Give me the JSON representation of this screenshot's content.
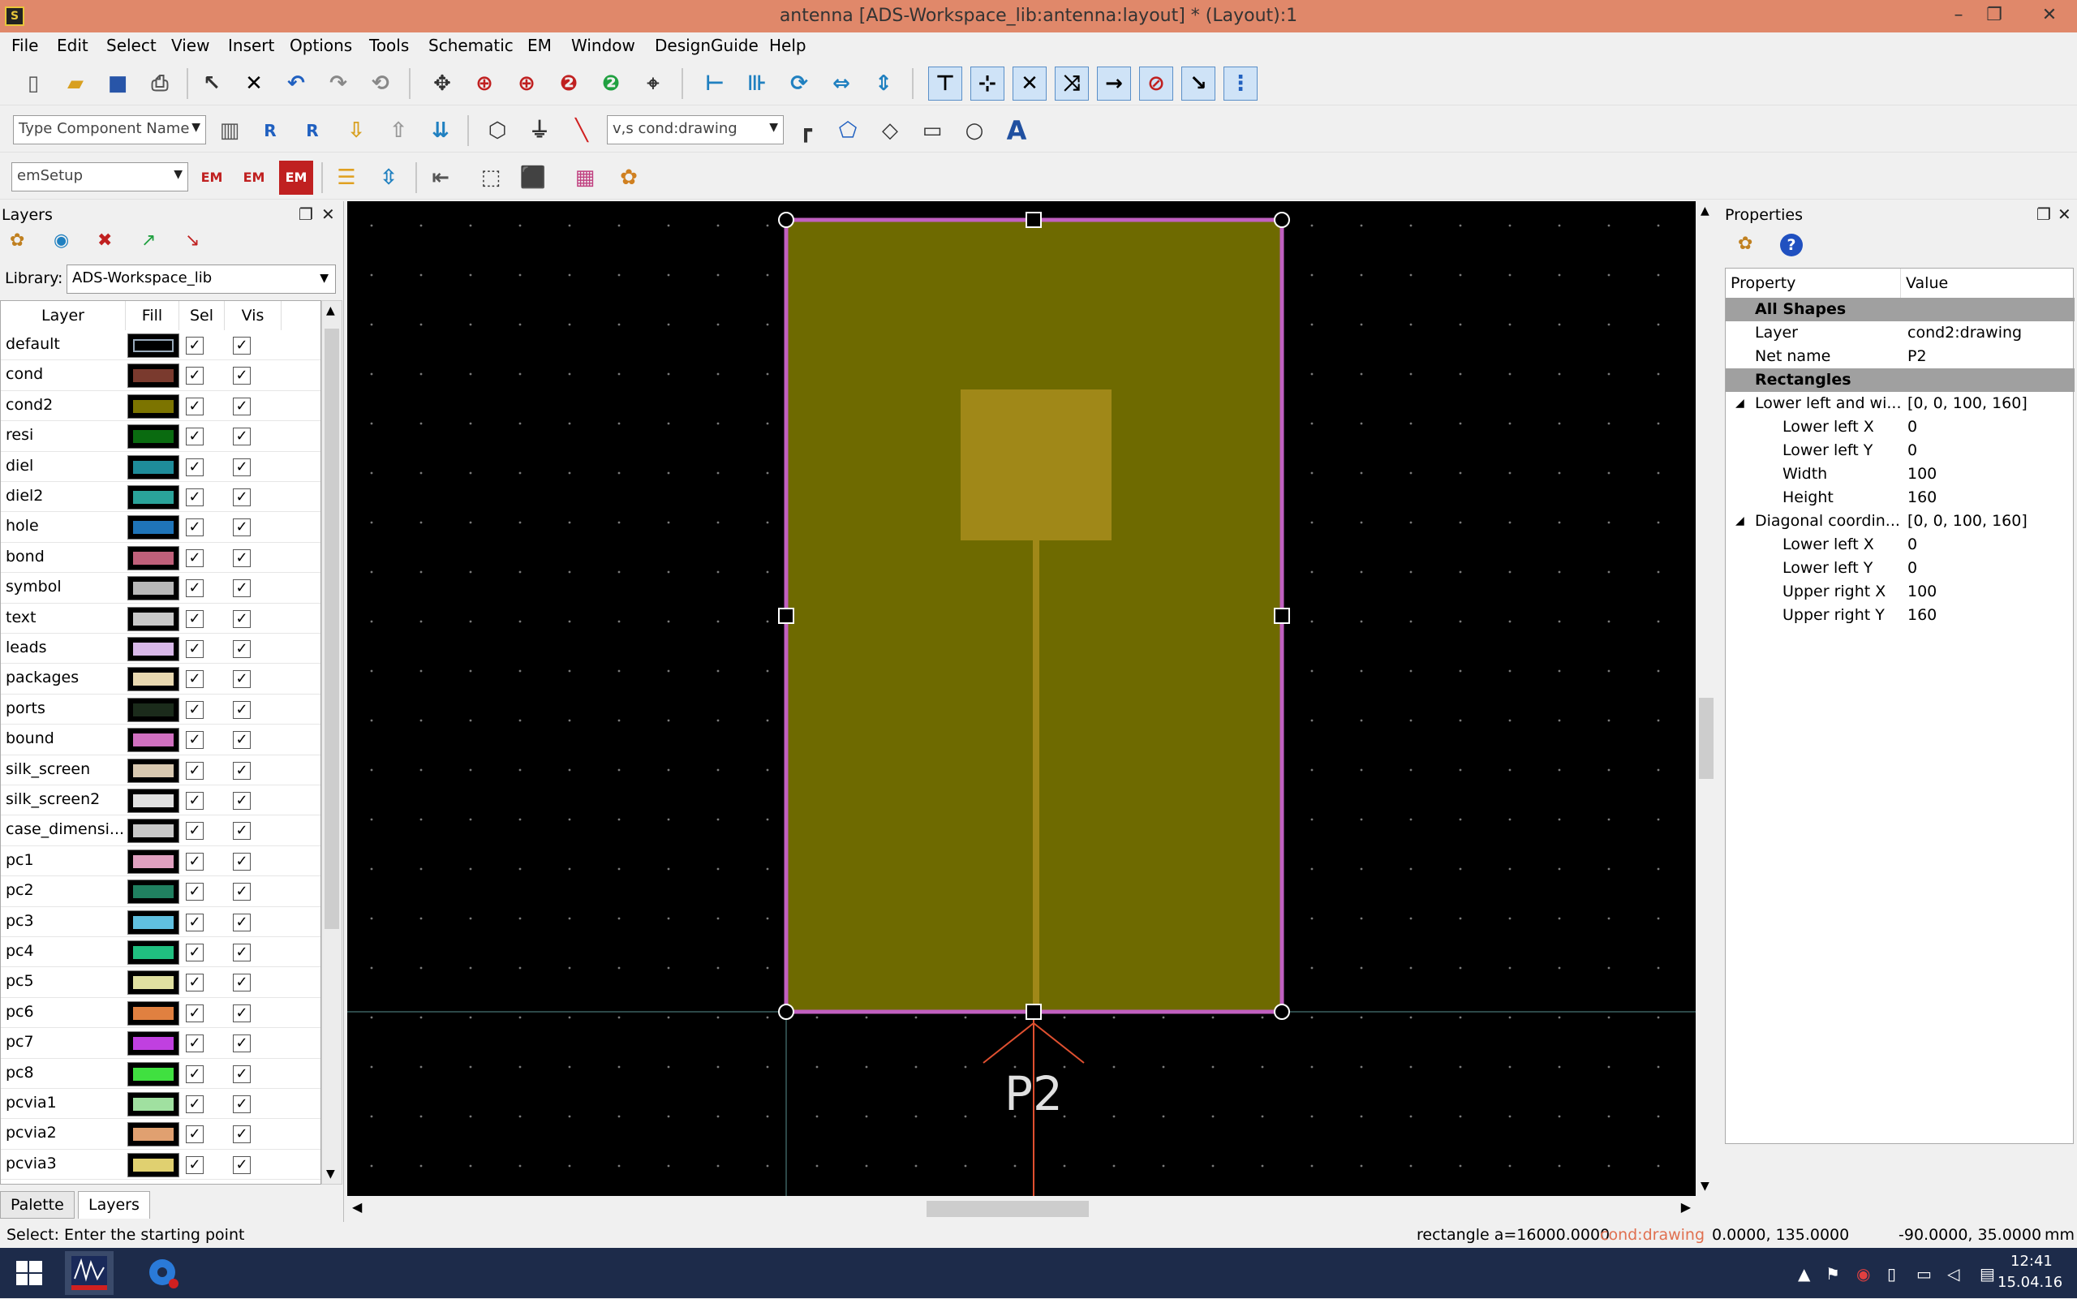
{
  "window": {
    "title": "antenna [ADS-Workspace_lib:antenna:layout] * (Layout):1",
    "minimize": "–",
    "restore": "❐",
    "close": "✕"
  },
  "menu": [
    "File",
    "Edit",
    "Select",
    "View",
    "Insert",
    "Options",
    "Tools",
    "Schematic",
    "EM",
    "Window",
    "DesignGuide",
    "Help"
  ],
  "toolbar": {
    "component_placeholder": "Type Component Name",
    "layer_combo": "v,s cond:drawing",
    "em_combo": "emSetup",
    "em_label": "EM"
  },
  "layers_panel": {
    "title": "Layers",
    "library_label": "Library:",
    "library_value": "ADS-Workspace_lib",
    "columns": [
      "Layer",
      "Fill",
      "Sel",
      "Vis"
    ],
    "layers": [
      {
        "name": "default",
        "color": "#000000"
      },
      {
        "name": "cond",
        "color": "#7a3a2e"
      },
      {
        "name": "cond2",
        "color": "#7c7400"
      },
      {
        "name": "resi",
        "color": "#0a6b10"
      },
      {
        "name": "diel",
        "color": "#1e8c9a"
      },
      {
        "name": "diel2",
        "color": "#2aa39a"
      },
      {
        "name": "hole",
        "color": "#1f74b8"
      },
      {
        "name": "bond",
        "color": "#c0607a"
      },
      {
        "name": "symbol",
        "color": "#b8b8b8"
      },
      {
        "name": "text",
        "color": "#c8c8c8"
      },
      {
        "name": "leads",
        "color": "#d8b8e8"
      },
      {
        "name": "packages",
        "color": "#e8d8b0"
      },
      {
        "name": "ports",
        "color": "#1b2b1b"
      },
      {
        "name": "bound",
        "color": "#d070c0"
      },
      {
        "name": "silk_screen",
        "color": "#d8c8b0"
      },
      {
        "name": "silk_screen2",
        "color": "#e0e0e0"
      },
      {
        "name": "case_dimensi...",
        "color": "#c8c8c8"
      },
      {
        "name": "pc1",
        "color": "#e0a0c0"
      },
      {
        "name": "pc2",
        "color": "#208060"
      },
      {
        "name": "pc3",
        "color": "#60c0e0"
      },
      {
        "name": "pc4",
        "color": "#20c080"
      },
      {
        "name": "pc5",
        "color": "#e0e0a0"
      },
      {
        "name": "pc6",
        "color": "#e08040"
      },
      {
        "name": "pc7",
        "color": "#c040e0"
      },
      {
        "name": "pc8",
        "color": "#40e040"
      },
      {
        "name": "pcvia1",
        "color": "#a0e0a0"
      },
      {
        "name": "pcvia2",
        "color": "#e0a070"
      },
      {
        "name": "pcvia3",
        "color": "#e0d070"
      }
    ],
    "tabs": [
      "Palette",
      "Layers"
    ]
  },
  "canvas": {
    "port_label": "P2",
    "colors": {
      "substrate": "#6e6a00",
      "patch": "#a08818",
      "outline": "#c060c0",
      "port": "#e05030"
    }
  },
  "properties_panel": {
    "title": "Properties",
    "columns": [
      "Property",
      "Value"
    ],
    "rows": [
      {
        "kind": "group",
        "key": "All Shapes",
        "value": ""
      },
      {
        "kind": "item",
        "key": "Layer",
        "value": "cond2:drawing"
      },
      {
        "kind": "item",
        "key": "Net name",
        "value": "P2"
      },
      {
        "kind": "group",
        "key": "Rectangles",
        "value": ""
      },
      {
        "kind": "expand",
        "key": "Lower left and wi...",
        "value": "[0, 0, 100, 160]"
      },
      {
        "kind": "sub",
        "key": "Lower left X",
        "value": "0"
      },
      {
        "kind": "sub",
        "key": "Lower left Y",
        "value": "0"
      },
      {
        "kind": "sub",
        "key": "Width",
        "value": "100"
      },
      {
        "kind": "sub",
        "key": "Height",
        "value": "160"
      },
      {
        "kind": "expand",
        "key": "Diagonal coordin...",
        "value": "[0, 0, 100, 160]"
      },
      {
        "kind": "sub",
        "key": "Lower left X",
        "value": "0"
      },
      {
        "kind": "sub",
        "key": "Lower left Y",
        "value": "0"
      },
      {
        "kind": "sub",
        "key": "Upper right X",
        "value": "100"
      },
      {
        "kind": "sub",
        "key": "Upper right Y",
        "value": "160"
      }
    ]
  },
  "status": {
    "prompt": "Select: Enter the starting point",
    "shape_info": "rectangle a=16000.0000",
    "layer": "cond:drawing",
    "coord1": "0.0000, 135.0000",
    "coord2": "-90.0000, 35.0000",
    "units": "mm"
  },
  "taskbar": {
    "time": "12:41",
    "date": "15.04.16"
  }
}
